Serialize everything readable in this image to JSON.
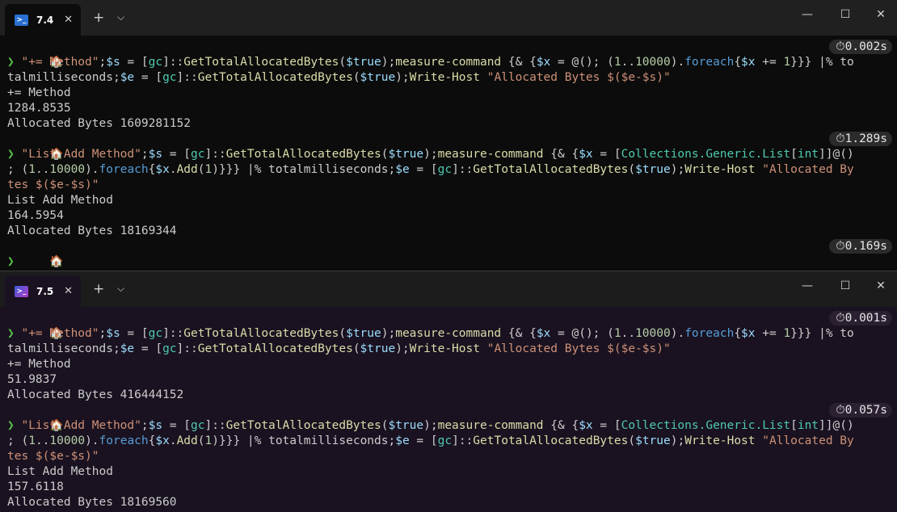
{
  "windows": [
    {
      "tab_title": "7.4",
      "tab_close": "✕",
      "new_tab": "+",
      "dropdown": "⌵",
      "controls": {
        "minimize": "—",
        "maximize": "☐",
        "close": "✕"
      },
      "timers": [
        "⏱0.002s",
        "⏱1.289s",
        "⏱0.169s"
      ],
      "outputs": [
        "+= Method",
        "1284.8535",
        "Allocated Bytes 1609281152",
        "List Add Method",
        "164.5954",
        "Allocated Bytes 18169344"
      ]
    },
    {
      "tab_title": "7.5",
      "tab_close": "✕",
      "new_tab": "+",
      "dropdown": "⌵",
      "controls": {
        "minimize": "—",
        "maximize": "☐",
        "close": "✕"
      },
      "timers": [
        "⏱0.001s",
        "⏱0.057s"
      ],
      "outputs": [
        "+= Method",
        "51.9837",
        "Allocated Bytes 416444152",
        "List Add Method",
        "157.6118",
        "Allocated Bytes 18169560"
      ]
    }
  ],
  "prompt": {
    "home_icon": "🏠",
    "arrow": "❯"
  },
  "commands": {
    "plus_eq": {
      "l1": [
        {
          "t": "\"+= Method\"",
          "c": "s"
        },
        {
          "t": ";",
          "c": "o"
        },
        {
          "t": "$s",
          "c": "v"
        },
        {
          "t": " = [",
          "c": "o"
        },
        {
          "t": "gc",
          "c": "g"
        },
        {
          "t": "]::",
          "c": "o"
        },
        {
          "t": "GetTotalAllocatedBytes",
          "c": "m"
        },
        {
          "t": "(",
          "c": "o"
        },
        {
          "t": "$true",
          "c": "v"
        },
        {
          "t": ");",
          "c": "o"
        },
        {
          "t": "measure-command",
          "c": "m"
        },
        {
          "t": " {& {",
          "c": "o"
        },
        {
          "t": "$x",
          "c": "v"
        },
        {
          "t": " = @(); (",
          "c": "o"
        },
        {
          "t": "1",
          "c": "n"
        },
        {
          "t": "..",
          "c": "o"
        },
        {
          "t": "10000",
          "c": "n"
        },
        {
          "t": ").",
          "c": "o"
        },
        {
          "t": "foreach",
          "c": "k"
        },
        {
          "t": "{",
          "c": "o"
        },
        {
          "t": "$x",
          "c": "v"
        },
        {
          "t": " += ",
          "c": "o"
        },
        {
          "t": "1",
          "c": "n"
        },
        {
          "t": "}}} |% to",
          "c": "o"
        }
      ],
      "l2": [
        {
          "t": "talmilliseconds;",
          "c": "o"
        },
        {
          "t": "$e",
          "c": "v"
        },
        {
          "t": " = [",
          "c": "o"
        },
        {
          "t": "gc",
          "c": "g"
        },
        {
          "t": "]::",
          "c": "o"
        },
        {
          "t": "GetTotalAllocatedBytes",
          "c": "m"
        },
        {
          "t": "(",
          "c": "o"
        },
        {
          "t": "$true",
          "c": "v"
        },
        {
          "t": ");",
          "c": "o"
        },
        {
          "t": "Write-Host",
          "c": "m"
        },
        {
          "t": " ",
          "c": "o"
        },
        {
          "t": "\"Allocated Bytes $($e-$s)\"",
          "c": "s"
        }
      ]
    },
    "list_add": {
      "l1": [
        {
          "t": "\"List Add Method\"",
          "c": "s"
        },
        {
          "t": ";",
          "c": "o"
        },
        {
          "t": "$s",
          "c": "v"
        },
        {
          "t": " = [",
          "c": "o"
        },
        {
          "t": "gc",
          "c": "g"
        },
        {
          "t": "]::",
          "c": "o"
        },
        {
          "t": "GetTotalAllocatedBytes",
          "c": "m"
        },
        {
          "t": "(",
          "c": "o"
        },
        {
          "t": "$true",
          "c": "v"
        },
        {
          "t": ");",
          "c": "o"
        },
        {
          "t": "measure-command",
          "c": "m"
        },
        {
          "t": " {& {",
          "c": "o"
        },
        {
          "t": "$x",
          "c": "v"
        },
        {
          "t": " = [",
          "c": "o"
        },
        {
          "t": "Collections.Generic.List",
          "c": "g"
        },
        {
          "t": "[",
          "c": "o"
        },
        {
          "t": "int",
          "c": "g"
        },
        {
          "t": "]]@()",
          "c": "o"
        }
      ],
      "l2": [
        {
          "t": "; (",
          "c": "o"
        },
        {
          "t": "1",
          "c": "n"
        },
        {
          "t": "..",
          "c": "o"
        },
        {
          "t": "10000",
          "c": "n"
        },
        {
          "t": ").",
          "c": "o"
        },
        {
          "t": "foreach",
          "c": "k"
        },
        {
          "t": "{",
          "c": "o"
        },
        {
          "t": "$x",
          "c": "v"
        },
        {
          "t": ".",
          "c": "o"
        },
        {
          "t": "Add",
          "c": "m"
        },
        {
          "t": "(",
          "c": "o"
        },
        {
          "t": "1",
          "c": "n"
        },
        {
          "t": ")}}} |% totalmilliseconds;",
          "c": "o"
        },
        {
          "t": "$e",
          "c": "v"
        },
        {
          "t": " = [",
          "c": "o"
        },
        {
          "t": "gc",
          "c": "g"
        },
        {
          "t": "]::",
          "c": "o"
        },
        {
          "t": "GetTotalAllocatedBytes",
          "c": "m"
        },
        {
          "t": "(",
          "c": "o"
        },
        {
          "t": "$true",
          "c": "v"
        },
        {
          "t": ");",
          "c": "o"
        },
        {
          "t": "Write-Host",
          "c": "m"
        },
        {
          "t": " ",
          "c": "o"
        },
        {
          "t": "\"Allocated By",
          "c": "s"
        }
      ],
      "l3": [
        {
          "t": "tes $($e-$s)\"",
          "c": "s"
        }
      ]
    }
  }
}
